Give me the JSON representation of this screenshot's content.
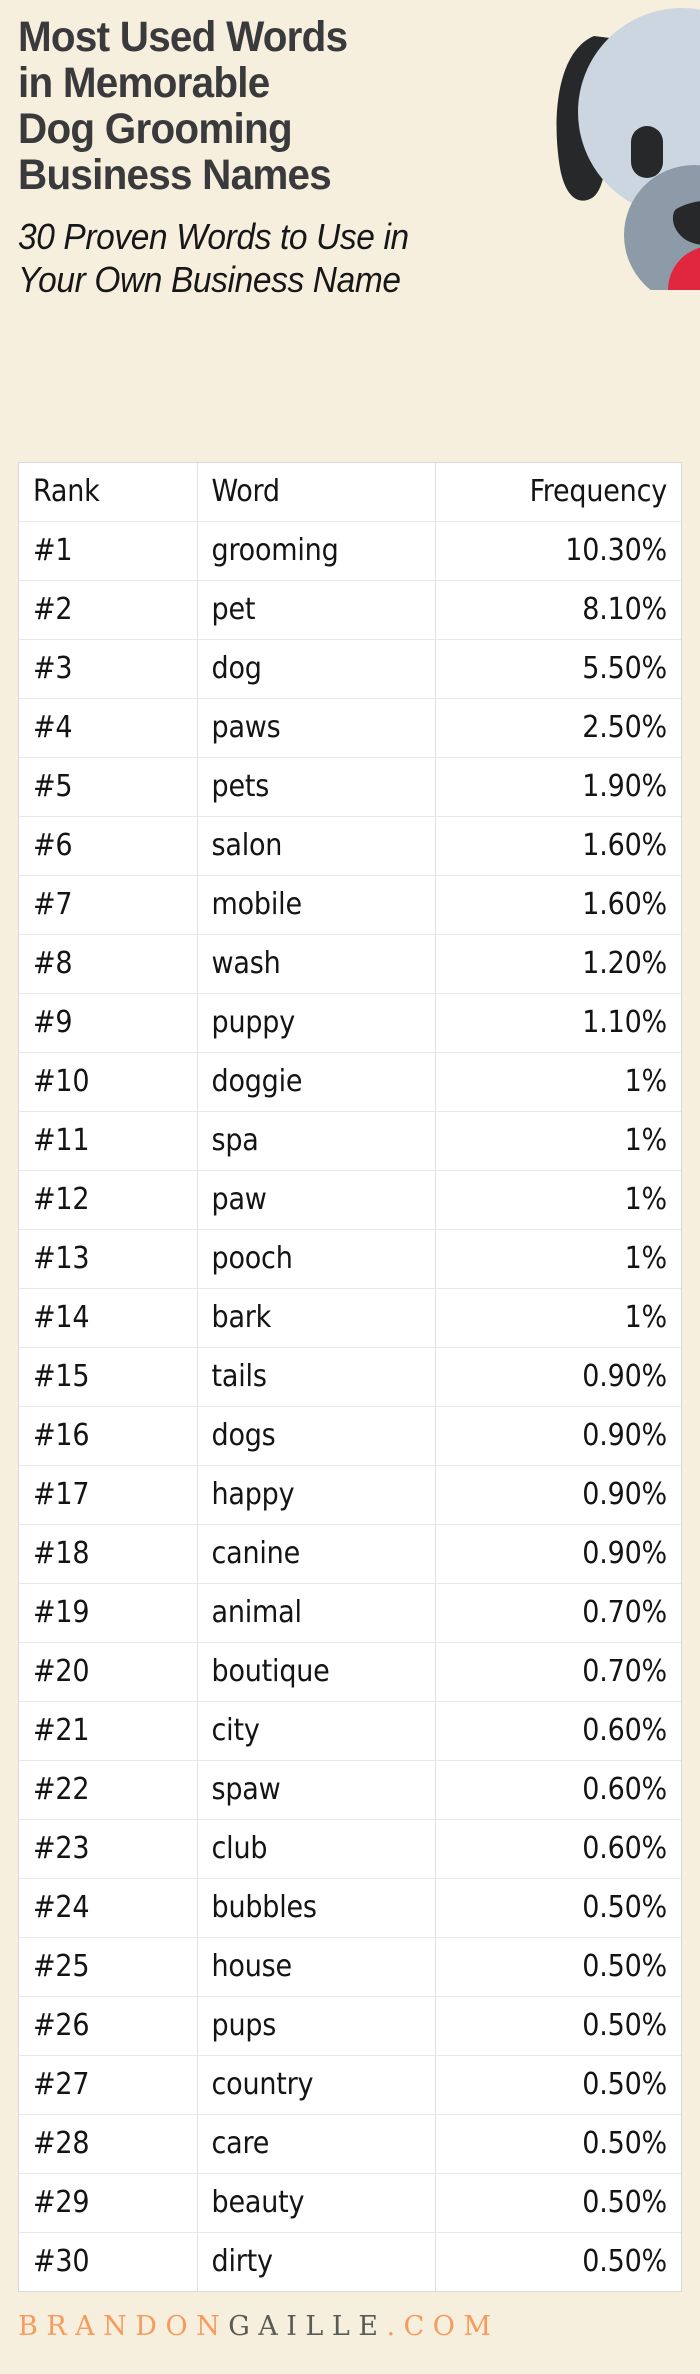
{
  "page": {
    "background_color": "#f6efdd"
  },
  "header": {
    "title_lines": [
      "Most Used Words",
      "in Memorable",
      "Dog Grooming",
      "Business Names"
    ],
    "subtitle_lines": [
      "30 Proven Words to Use in",
      "Your Own Business Name"
    ],
    "title_color": "#3a3a3c",
    "subtitle_color": "#17171a",
    "illustration": {
      "name": "dog-head-illustration",
      "colors": {
        "head": "#ccd6e0",
        "ear": "#26282a",
        "eye": "#26282a",
        "muzzle": "#8d9ba8",
        "nose": "#26282a",
        "tongue": "#e0273f"
      }
    }
  },
  "table": {
    "columns": [
      "Rank",
      "Word",
      "Frequency"
    ],
    "rows": [
      {
        "rank": "#1",
        "word": "grooming",
        "frequency": "10.30%"
      },
      {
        "rank": "#2",
        "word": "pet",
        "frequency": "8.10%"
      },
      {
        "rank": "#3",
        "word": "dog",
        "frequency": "5.50%"
      },
      {
        "rank": "#4",
        "word": "paws",
        "frequency": "2.50%"
      },
      {
        "rank": "#5",
        "word": "pets",
        "frequency": "1.90%"
      },
      {
        "rank": "#6",
        "word": "salon",
        "frequency": "1.60%"
      },
      {
        "rank": "#7",
        "word": "mobile",
        "frequency": "1.60%"
      },
      {
        "rank": "#8",
        "word": "wash",
        "frequency": "1.20%"
      },
      {
        "rank": "#9",
        "word": "puppy",
        "frequency": "1.10%"
      },
      {
        "rank": "#10",
        "word": "doggie",
        "frequency": "1%"
      },
      {
        "rank": "#11",
        "word": "spa",
        "frequency": "1%"
      },
      {
        "rank": "#12",
        "word": "paw",
        "frequency": "1%"
      },
      {
        "rank": "#13",
        "word": "pooch",
        "frequency": "1%"
      },
      {
        "rank": "#14",
        "word": "bark",
        "frequency": "1%"
      },
      {
        "rank": "#15",
        "word": "tails",
        "frequency": "0.90%"
      },
      {
        "rank": "#16",
        "word": "dogs",
        "frequency": "0.90%"
      },
      {
        "rank": "#17",
        "word": "happy",
        "frequency": "0.90%"
      },
      {
        "rank": "#18",
        "word": "canine",
        "frequency": "0.90%"
      },
      {
        "rank": "#19",
        "word": "animal",
        "frequency": "0.70%"
      },
      {
        "rank": "#20",
        "word": "boutique",
        "frequency": "0.70%"
      },
      {
        "rank": "#21",
        "word": "city",
        "frequency": "0.60%"
      },
      {
        "rank": "#22",
        "word": "spaw",
        "frequency": "0.60%"
      },
      {
        "rank": "#23",
        "word": "club",
        "frequency": "0.60%"
      },
      {
        "rank": "#24",
        "word": "bubbles",
        "frequency": "0.50%"
      },
      {
        "rank": "#25",
        "word": "house",
        "frequency": "0.50%"
      },
      {
        "rank": "#26",
        "word": "pups",
        "frequency": "0.50%"
      },
      {
        "rank": "#27",
        "word": "country",
        "frequency": "0.50%"
      },
      {
        "rank": "#28",
        "word": "care",
        "frequency": "0.50%"
      },
      {
        "rank": "#29",
        "word": "beauty",
        "frequency": "0.50%"
      },
      {
        "rank": "#30",
        "word": "dirty",
        "frequency": "0.50%"
      }
    ]
  },
  "footer": {
    "brand_part1": "BRANDON",
    "brand_part2": "GAILLE",
    "brand_part3": ".COM",
    "color_accent": "#f79b5c",
    "color_dark": "#5b5b55"
  },
  "chart_data": {
    "type": "table",
    "title": "Most Used Words in Memorable Dog Grooming Business Names",
    "subtitle": "30 Proven Words to Use in Your Own Business Name",
    "columns": [
      "Rank",
      "Word",
      "Frequency"
    ],
    "xlabel": "Word",
    "ylabel": "Frequency (%)",
    "categories": [
      "grooming",
      "pet",
      "dog",
      "paws",
      "pets",
      "salon",
      "mobile",
      "wash",
      "puppy",
      "doggie",
      "spa",
      "paw",
      "pooch",
      "bark",
      "tails",
      "dogs",
      "happy",
      "canine",
      "animal",
      "boutique",
      "city",
      "spaw",
      "club",
      "bubbles",
      "house",
      "pups",
      "country",
      "care",
      "beauty",
      "dirty"
    ],
    "values": [
      10.3,
      8.1,
      5.5,
      2.5,
      1.9,
      1.6,
      1.6,
      1.2,
      1.1,
      1.0,
      1.0,
      1.0,
      1.0,
      1.0,
      0.9,
      0.9,
      0.9,
      0.9,
      0.7,
      0.7,
      0.6,
      0.6,
      0.6,
      0.5,
      0.5,
      0.5,
      0.5,
      0.5,
      0.5,
      0.5
    ],
    "ranks": [
      "#1",
      "#2",
      "#3",
      "#4",
      "#5",
      "#6",
      "#7",
      "#8",
      "#9",
      "#10",
      "#11",
      "#12",
      "#13",
      "#14",
      "#15",
      "#16",
      "#17",
      "#18",
      "#19",
      "#20",
      "#21",
      "#22",
      "#23",
      "#24",
      "#25",
      "#26",
      "#27",
      "#28",
      "#29",
      "#30"
    ],
    "value_labels": [
      "10.30%",
      "8.10%",
      "5.50%",
      "2.50%",
      "1.90%",
      "1.60%",
      "1.60%",
      "1.20%",
      "1.10%",
      "1%",
      "1%",
      "1%",
      "1%",
      "1%",
      "0.90%",
      "0.90%",
      "0.90%",
      "0.90%",
      "0.70%",
      "0.70%",
      "0.60%",
      "0.60%",
      "0.60%",
      "0.50%",
      "0.50%",
      "0.50%",
      "0.50%",
      "0.50%",
      "0.50%",
      "0.50%"
    ],
    "ylim": [
      0,
      10.3
    ],
    "grid": false,
    "legend": "none"
  }
}
